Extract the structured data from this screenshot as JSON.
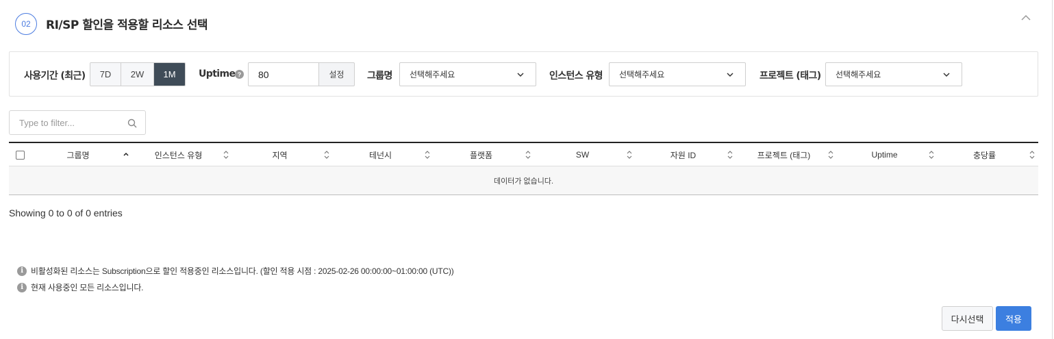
{
  "header": {
    "step": "02",
    "title": "RI/SP 할인을 적용할 리소스 선택"
  },
  "filters": {
    "period_label": "사용기간 (최근)",
    "periods": [
      "7D",
      "2W",
      "1M"
    ],
    "active_period": "1M",
    "uptime_label": "Uptime",
    "uptime_value": "80",
    "set_label": "설정",
    "group_label": "그룹명",
    "group_value": "선택해주세요",
    "instance_label": "인스턴스 유형",
    "instance_value": "선택해주세요",
    "project_label": "프로젝트 (태그)",
    "project_value": "선택해주세요"
  },
  "search": {
    "placeholder": "Type to filter..."
  },
  "table": {
    "columns": [
      "그룹명",
      "인스턴스 유형",
      "지역",
      "테넌시",
      "플랫폼",
      "SW",
      "자원 ID",
      "프로젝트 (태그)",
      "Uptime",
      "충당률"
    ],
    "empty_text": "데이터가 없습니다."
  },
  "showing": "Showing 0 to 0 of 0 entries",
  "notes": [
    "비활성화된 리소스는 Subscription으로 할인 적용중인 리소스입니다. (할인 적용 시점 : 2025-02-26 00:00:00~01:00:00 (UTC))",
    "현재 사용중인 모든 리소스입니다."
  ],
  "buttons": {
    "reselect": "다시선택",
    "apply": "적용"
  },
  "colors": {
    "accent": "#3c7fe0",
    "active_period": "#3f4c58"
  }
}
